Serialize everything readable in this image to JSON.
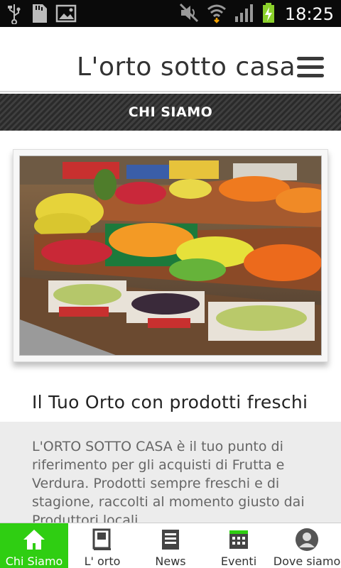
{
  "status_bar": {
    "time": "18:25",
    "icons": [
      "usb-icon",
      "sd-card-icon",
      "image-icon",
      "mute-icon",
      "wifi-icon",
      "signal-icon",
      "battery-charging-icon"
    ]
  },
  "header": {
    "title": "L'orto sotto casa",
    "menu_icon": "hamburger-menu-icon"
  },
  "section": {
    "title": "CHI SIAMO"
  },
  "content": {
    "heading": "Il Tuo Orto con prodotti freschi",
    "body": "L'ORTO SOTTO CASA è il tuo punto di riferimento per gli acquisti di Frutta e Verdura. Prodotti sempre freschi e di stagione, raccolti al momento giusto dai Produttori locali."
  },
  "bottom_nav": {
    "active_color": "#2fce12",
    "items": [
      {
        "label": "Chi Siamo",
        "icon": "home-icon"
      },
      {
        "label": "L' orto",
        "icon": "book-icon"
      },
      {
        "label": "News",
        "icon": "news-icon"
      },
      {
        "label": "Eventi",
        "icon": "calendar-icon"
      },
      {
        "label": "Dove siamo",
        "icon": "person-icon"
      }
    ]
  }
}
